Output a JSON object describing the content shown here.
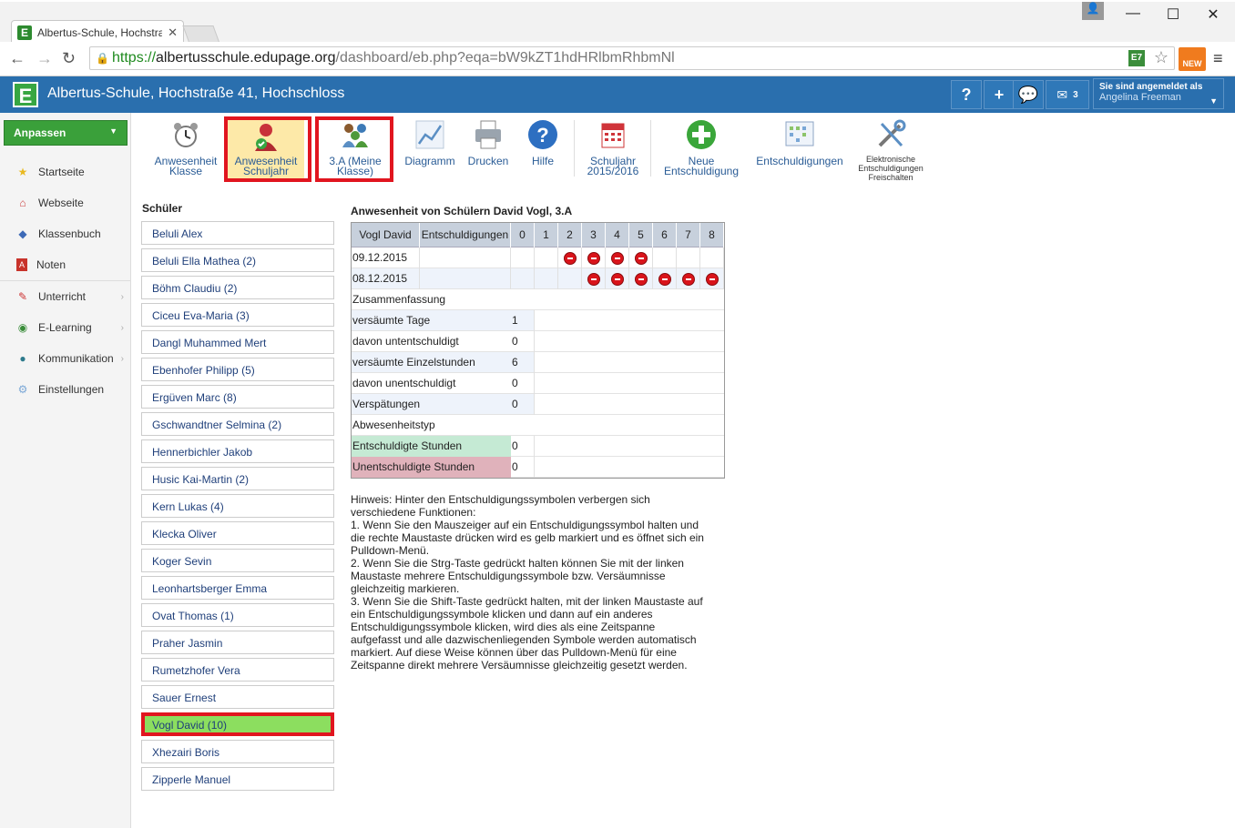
{
  "browser": {
    "tab_title": "Albertus-Schule, Hochstra",
    "url_scheme": "https://",
    "url_domain": "albertusschule.edupage.org",
    "url_path": "/dashboard/eb.php?eqa=bW9kZT1hdHRlbmRhbmNl",
    "ext_label": "E7",
    "new_badge": "NEW"
  },
  "header": {
    "logo": "E",
    "school": "Albertus-Schule, Hochstraße 41, Hochschloss",
    "help": "?",
    "plus": "+",
    "mail_count": "3",
    "login_title": "Sie sind angemeldet als",
    "login_user": "Angelina Freeman"
  },
  "sidebar": {
    "anpassen": "Anpassen",
    "items": [
      {
        "label": "Startseite",
        "icon": "star-icon"
      },
      {
        "label": "Webseite",
        "icon": "home-icon"
      },
      {
        "label": "Klassenbuch",
        "icon": "book-icon"
      },
      {
        "label": "Noten",
        "icon": "grades-icon"
      },
      {
        "label": "Unterricht",
        "icon": "lesson-icon"
      },
      {
        "label": "E-Learning",
        "icon": "elearning-icon"
      },
      {
        "label": "Kommunikation",
        "icon": "communication-icon"
      },
      {
        "label": "Einstellungen",
        "icon": "settings-icon"
      }
    ]
  },
  "toolbar": {
    "anwesenheit_klasse_1": "Anwesenheit",
    "anwesenheit_klasse_2": "Klasse",
    "anwesenheit_schuljahr_1": "Anwesenheit",
    "anwesenheit_schuljahr_2": "Schuljahr",
    "meine_klasse_1": "3.A (Meine",
    "meine_klasse_2": "Klasse)",
    "diagramm": "Diagramm",
    "drucken": "Drucken",
    "hilfe": "Hilfe",
    "schuljahr_1": "Schuljahr",
    "schuljahr_2": "2015/2016",
    "neue_1": "Neue",
    "neue_2": "Entschuldigung",
    "entschuldigungen": "Entschuldigungen",
    "elektronisch_1": "Elektronische",
    "elektronisch_2": "Entschuldigungen",
    "elektronisch_3": "Freischalten"
  },
  "students": {
    "title": "Schüler",
    "list": [
      "Beluli Alex",
      "Beluli Ella Mathea (2)",
      "Böhm Claudiu (2)",
      "Ciceu Eva-Maria (3)",
      "Dangl Muhammed Mert",
      "Ebenhofer Philipp (5)",
      "Ergüven Marc (8)",
      "Gschwandtner Selmina (2)",
      "Hennerbichler Jakob",
      "Husic Kai-Martin (2)",
      "Kern Lukas (4)",
      "Klecka Oliver",
      "Koger Sevin",
      "Leonhartsberger Emma",
      "Ovat Thomas (1)",
      "Praher Jasmin",
      "Rumetzhofer Vera",
      "Sauer Ernest",
      "Vogl David (10)",
      "Xhezairi Boris",
      "Zipperle Manuel"
    ],
    "selected_index": 18
  },
  "attendance": {
    "title": "Anwesenheit von Schülern David Vogl, 3.A",
    "student": "Vogl David",
    "col_excuses": "Entschuldigungen",
    "periods": [
      "0",
      "1",
      "2",
      "3",
      "4",
      "5",
      "6",
      "7",
      "8"
    ],
    "rows": [
      {
        "date": "09.12.2015",
        "absent_periods": [
          2,
          3,
          4,
          5
        ]
      },
      {
        "date": "08.12.2015",
        "absent_periods": [
          3,
          4,
          5,
          6,
          7,
          8
        ]
      }
    ],
    "summary_title": "Zusammenfassung",
    "summary": [
      {
        "label": "versäumte Tage",
        "value": "1"
      },
      {
        "label": "davon untentschuldigt",
        "value": "0"
      },
      {
        "label": "versäumte Einzelstunden",
        "value": "6"
      },
      {
        "label": "davon unentschuldigt",
        "value": "0"
      },
      {
        "label": "Verspätungen",
        "value": "0"
      }
    ],
    "type_title": "Abwesenheitstyp",
    "types": [
      {
        "label": "Entschuldigte Stunden",
        "value": "0",
        "color": "#c5ead4"
      },
      {
        "label": "Unentschuldigte Stunden",
        "value": "0",
        "color": "#e0b2bb"
      }
    ]
  },
  "hint": [
    "Hinweis: Hinter den Entschuldigungssymbolen verbergen sich",
    "verschiedene Funktionen:",
    "1. Wenn Sie den Mauszeiger auf ein Entschuldigungssymbol halten und",
    "die rechte Maustaste drücken wird es gelb markiert und es öffnet sich ein",
    "Pulldown-Menü.",
    "2. Wenn Sie die Strg-Taste gedrückt halten können Sie mit der linken",
    "Maustaste mehrere Entschuldigungssymbole bzw. Versäumnisse",
    "gleichzeitig markieren.",
    "3. Wenn Sie die Shift-Taste gedrückt halten, mit der linken Maustaste auf",
    "ein Entschuldigungssymbole klicken und dann auf ein anderes",
    "Entschuldigungssymbole klicken, wird dies als eine Zeitspanne",
    "aufgefasst und alle dazwischenliegenden Symbole werden automatisch",
    "markiert. Auf diese Weise können über das Pulldown-Menü für eine",
    "Zeitspanne direkt mehrere Versäumnisse gleichzeitig gesetzt werden."
  ]
}
